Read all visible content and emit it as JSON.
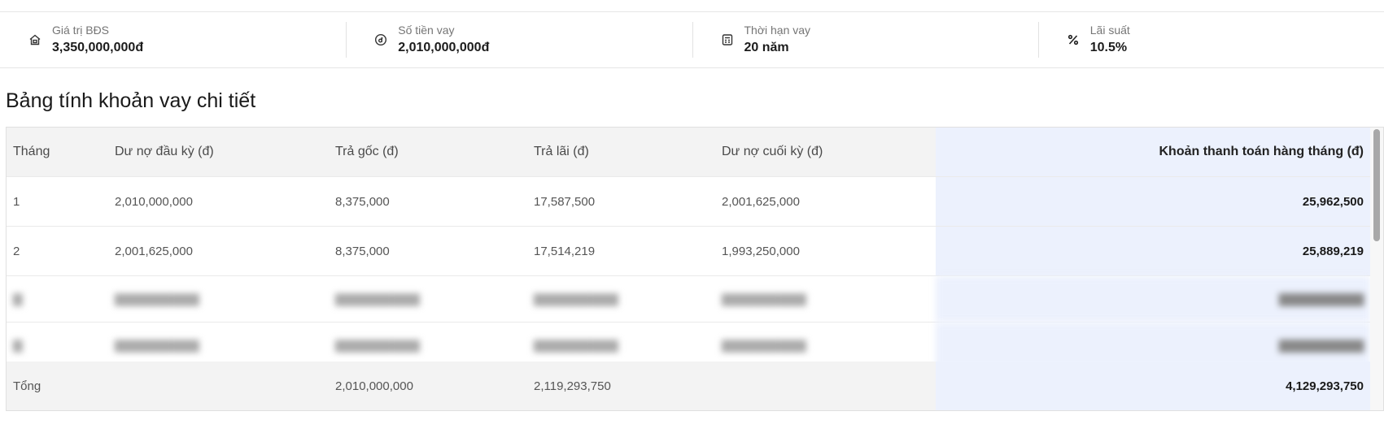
{
  "summary": [
    {
      "icon": "house-icon",
      "label": "Giá trị BĐS",
      "value": "3,350,000,000đ"
    },
    {
      "icon": "dong-coin-icon",
      "label": "Số tiền vay",
      "value": "2,010,000,000đ"
    },
    {
      "icon": "calculator-icon",
      "label": "Thời hạn vay",
      "value": "20 năm"
    },
    {
      "icon": "percent-icon",
      "label": "Lãi suất",
      "value": "10.5%"
    }
  ],
  "section_title": "Bảng tính khoản vay chi tiết",
  "table": {
    "headers": [
      "Tháng",
      "Dư nợ đầu kỳ (đ)",
      "Trả gốc (đ)",
      "Trả lãi (đ)",
      "Dư nợ cuối kỳ (đ)",
      "Khoản thanh toán hàng tháng (đ)"
    ],
    "rows": [
      [
        "1",
        "2,010,000,000",
        "8,375,000",
        "17,587,500",
        "2,001,625,000",
        "25,962,500"
      ],
      [
        "2",
        "2,001,625,000",
        "8,375,000",
        "17,514,219",
        "1,993,250,000",
        "25,889,219"
      ]
    ],
    "total": {
      "label": "Tổng",
      "principal": "2,010,000,000",
      "interest": "2,119,293,750",
      "payment": "4,129,293,750"
    }
  },
  "colors": {
    "highlight_column": "#ecf1fd",
    "header_background": "#f3f3f3"
  }
}
